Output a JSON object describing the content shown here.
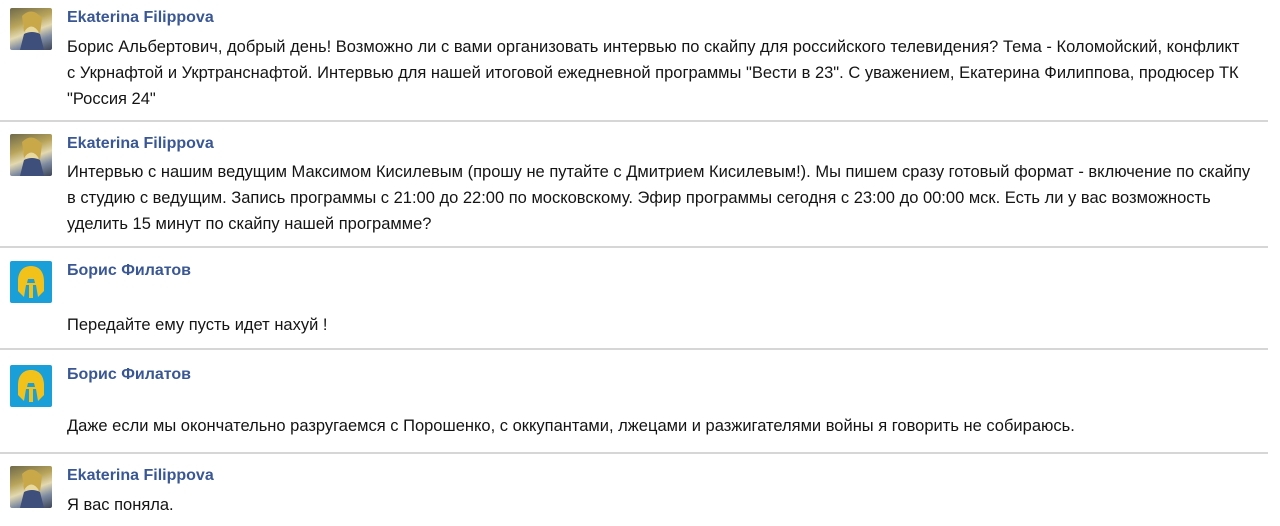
{
  "messages": [
    {
      "author": "Ekaterina Filippova",
      "avatar": "photo-avatar",
      "text": "Борис Альбертович, добрый день! Возможно ли с вами организовать интервью по скайпу для российского телевидения? Тема - Коломойский, конфликт с Укрнафтой и Укртранснафтой. Интервью для нашей итоговой ежедневной программы \"Вести в 23\". С уважением, Екатерина Филиппова, продюсер ТК \"Россия 24\""
    },
    {
      "author": "Ekaterina Filippova",
      "avatar": "photo-avatar",
      "text": "Интервью с нашим ведущим Максимом Кисилевым (прошу не путайте с Дмитрием Кисилевым!). Мы пишем сразу готовый формат - включение по скайпу в студию с ведущим. Запись программы с 21:00 до 22:00 по московскому. Эфир программы сегодня с 23:00 до 00:00 мск. Есть ли у вас возможность уделить 15 минут по скайпу нашей программе?"
    },
    {
      "author": "Борис Филатов",
      "avatar": "spartan-helmet-avatar",
      "text": "Передайте ему пусть идет нахуй !"
    },
    {
      "author": "Борис Филатов",
      "avatar": "spartan-helmet-avatar",
      "text": "Даже если мы окончательно разругаемся с Порошенко, с оккупантами, лжецами и разжигателями войны я говорить не собираюсь."
    },
    {
      "author": "Ekaterina Filippova",
      "avatar": "photo-avatar",
      "text": "Я вас поняла."
    }
  ],
  "colors": {
    "author_name": "#3a5795",
    "message_text": "#141414",
    "divider": "#d6d6d6",
    "helmet_background": "#1b9fd9",
    "helmet": "#f2c21a"
  }
}
